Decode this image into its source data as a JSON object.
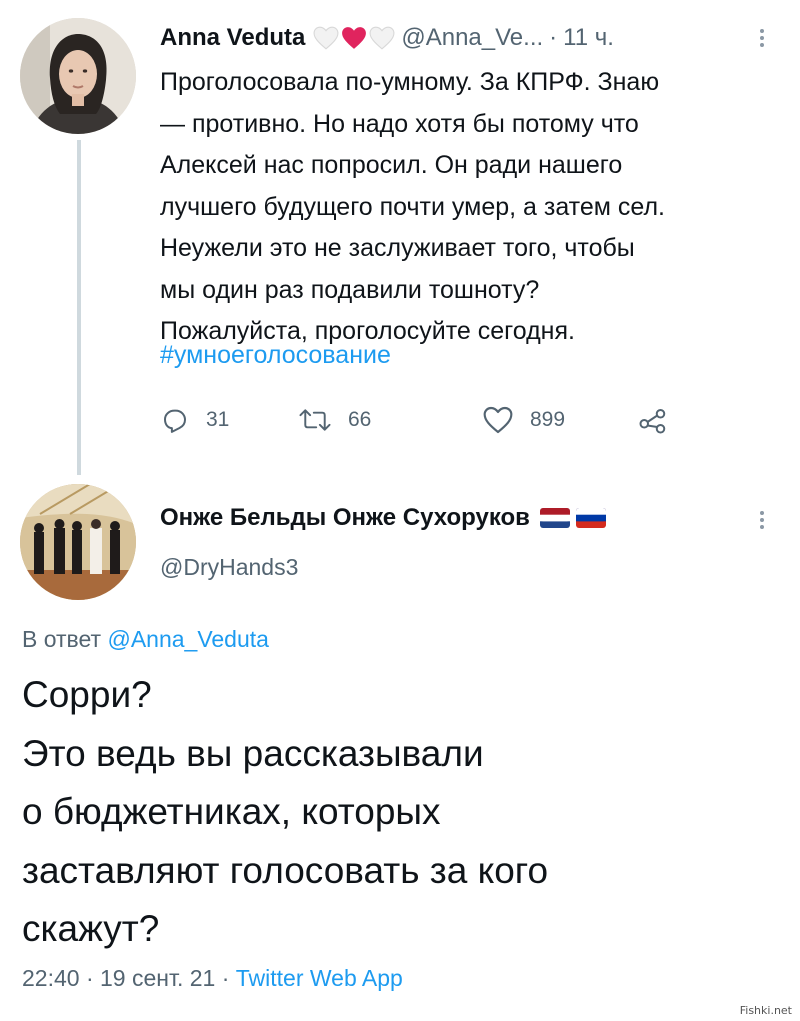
{
  "tweet": {
    "author_name": "Anna Veduta",
    "handle": "@Anna_Ve...",
    "separator": "·",
    "time": "11 ч.",
    "text": "Проголосовала по-умному. За КПРФ. Знаю\n— противно. Но надо хотя бы потому что\nАлексей нас попросил. Он ради нашего\nлучшего будущего почти умер, а затем сел.\nНеужели это не заслуживает того, чтобы\nмы один раз подавили тошноту?\nПожалуйста, проголосуйте сегодня.",
    "hashtag": "#умноеголосование",
    "replies": "31",
    "retweets": "66",
    "likes": "899",
    "emoji_icons": [
      "white-heart-icon",
      "red-heart-icon",
      "white-heart-icon"
    ]
  },
  "reply": {
    "author_name": "Онже Бельды Онже Сухоруков",
    "flag_icons": [
      "netherlands-flag-icon",
      "russia-flag-icon"
    ],
    "handle": "@DryHands3",
    "reply_prefix": "В ответ",
    "reply_mention": "@Anna_Veduta",
    "text": "Сорри?\nЭто ведь вы рассказывали\nо бюджетниках, которых\nзаставляют голосовать за кого\nскажут?",
    "timestamp": "22:40 · 19 сент. 21 ·",
    "source": "Twitter Web App"
  },
  "watermark": "Fishki.net",
  "colors": {
    "link": "#1d9bf0",
    "secondary_text": "#536471",
    "heart_red": "#e0245e"
  }
}
